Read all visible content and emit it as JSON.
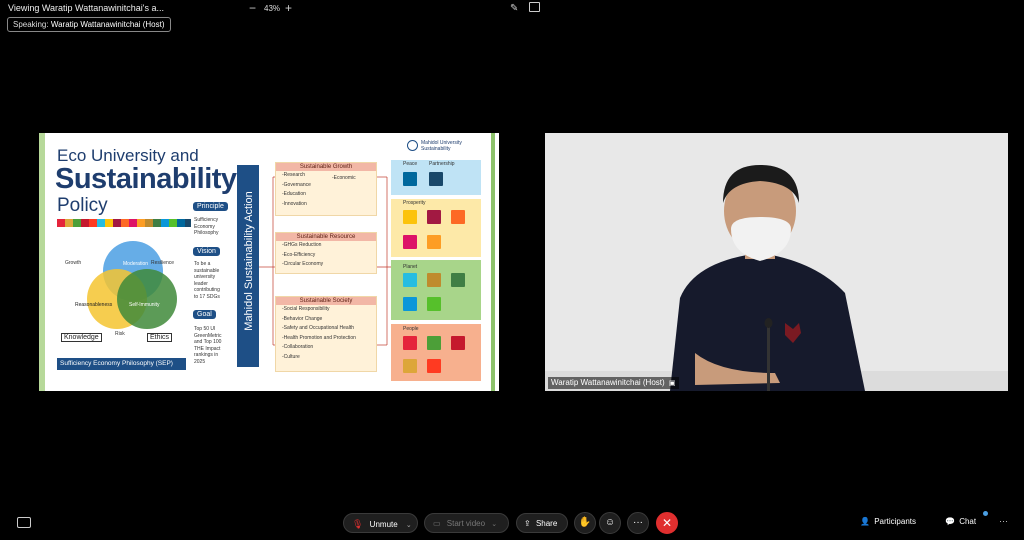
{
  "header": {
    "title": "Viewing Waratip Wattanawinitchai's a...",
    "zoom": "43%",
    "speaking_label": "Speaking:",
    "speaking_name": "Waratip Wattanawinitchai (Host)"
  },
  "slide": {
    "title_line1": "Eco University and",
    "title_line2": "Sustainability",
    "title_line3": "Policy",
    "principle_label": "Principle",
    "principle_text": [
      "Sufficiency",
      "Economy",
      "Philosophy"
    ],
    "vision_label": "Vision",
    "vision_text": [
      "To be a",
      "sustainable",
      "university",
      "leader",
      "contributing",
      "to 17 SDGs"
    ],
    "goal_label": "Goal",
    "goal_text": [
      "Top 50 UI",
      "GreenMetric",
      "and Top 100",
      "THE Impact",
      "rankings in",
      "2025"
    ],
    "venn": {
      "moderation": "Moderation",
      "reasonableness": "Reasonableness",
      "self_immunity": "Self-Immunity",
      "growth": "Growth",
      "resilience": "Resilience",
      "risk": "Risk"
    },
    "knowledge": "Knowledge",
    "ethics": "Ethics",
    "sep_banner": "Sufficiency Economy Philosophy (SEP)",
    "action_label": "Mahidol Sustainability Action",
    "logo_text": [
      "Mahidol University",
      "Sustainability"
    ],
    "growth": {
      "title": "Sustainable Growth",
      "items": [
        "-Research",
        "-Governance",
        "-Education",
        "-Innovation"
      ],
      "extra": "-Economic"
    },
    "resource": {
      "title": "Sustainable Resource",
      "items": [
        "-GHGs Reduction",
        "-Eco-Efficiency",
        "-Circular Economy"
      ]
    },
    "society": {
      "title": "Sustainable Society",
      "items": [
        "-Social Responsibility",
        "-Behavior Change",
        "-Safety and Occupational Health",
        "-Health Promotion and Protection",
        "-Collaboration",
        "-Culture"
      ]
    },
    "sdg_groups": {
      "peace": "Peace",
      "partnership": "Partnership",
      "prosperity": "Prosperity",
      "planet": "Planet",
      "people": "People"
    }
  },
  "video": {
    "participant_name": "Waratip Wattanawinitchai (Host)"
  },
  "toolbar": {
    "unmute": "Unmute",
    "start_video": "Start video",
    "share": "Share",
    "more": "···",
    "participants": "Participants",
    "chat": "Chat",
    "overflow": "···"
  },
  "colors": {
    "end_call": "#e02f2f",
    "slide_navy": "#1e4f86",
    "accent_blue": "#4b9fe3"
  }
}
